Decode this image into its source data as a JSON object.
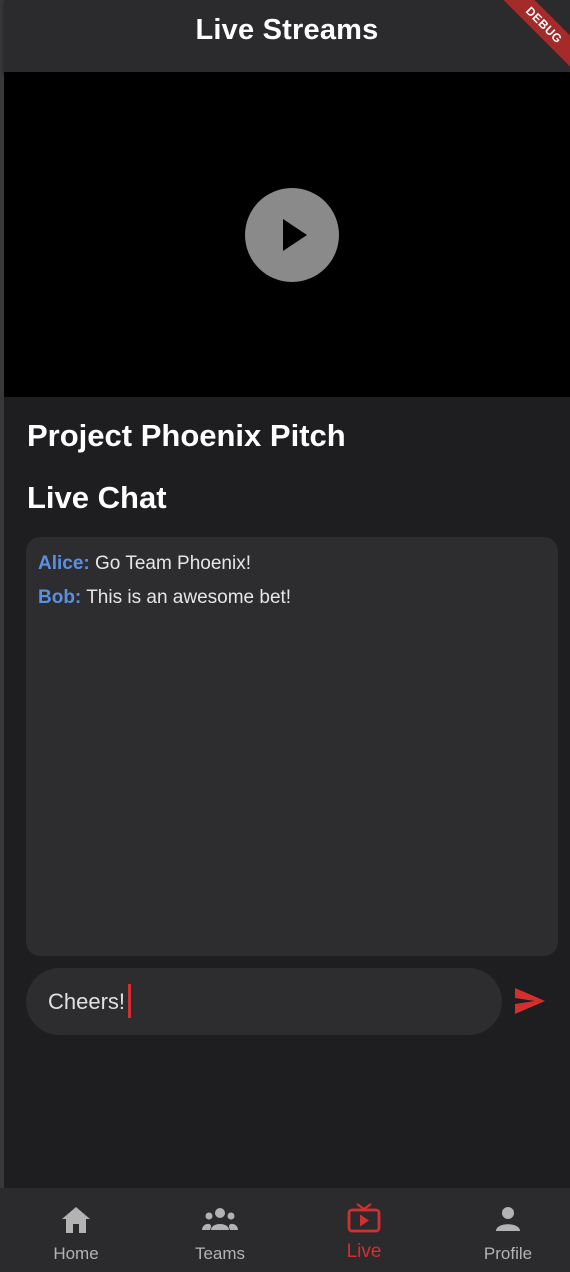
{
  "appbar": {
    "title": "Live Streams",
    "debug_banner": "DEBUG"
  },
  "video": {
    "play_icon": "play-icon"
  },
  "stream": {
    "title": "Project Phoenix Pitch"
  },
  "chat": {
    "heading": "Live Chat",
    "messages": [
      {
        "author": "Alice:",
        "text": "Go Team Phoenix!"
      },
      {
        "author": "Bob:",
        "text": "This is an awesome bet!"
      }
    ],
    "input_value": "Cheers!",
    "send_icon": "send-icon"
  },
  "nav": {
    "items": [
      {
        "label": "Home",
        "icon": "home-icon"
      },
      {
        "label": "Teams",
        "icon": "groups-icon"
      },
      {
        "label": "Live",
        "icon": "live-tv-icon",
        "active": true
      },
      {
        "label": "Profile",
        "icon": "person-icon"
      }
    ]
  },
  "colors": {
    "accent": "#d32f2f",
    "author": "#5b8fe3",
    "background": "#1e1e21",
    "surface": "#2d2d30"
  }
}
